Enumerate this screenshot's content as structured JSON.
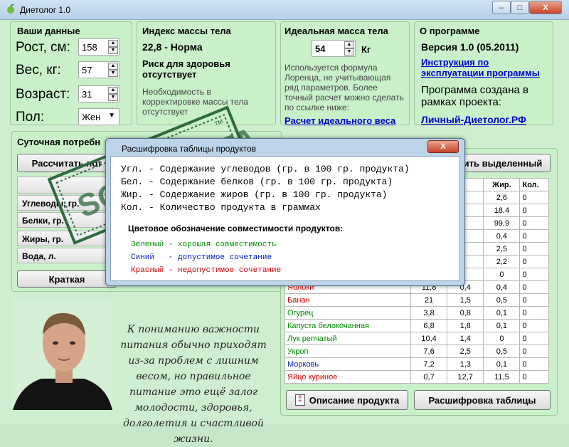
{
  "window": {
    "title": "Диетолог 1.0",
    "min": "–",
    "max": "□",
    "close": "X"
  },
  "your_data": {
    "title": "Ваши данные",
    "height_label": "Рост, см:",
    "height_value": "158",
    "weight_label": "Вес, кг:",
    "weight_value": "57",
    "age_label": "Возраст:",
    "age_value": "31",
    "sex_label": "Пол:",
    "sex_value": "Жен"
  },
  "bmi": {
    "title": "Индекс массы тела",
    "value": "22,8 - Норма",
    "risk": "Риск для здоровья отсутствует",
    "note": "Необходимость в корректировке массы тела отсутствует"
  },
  "ideal": {
    "title": "Идеальная масса тела",
    "value": "54",
    "unit": "Кг",
    "note": "Используется формула Лоренца, не учитывающая ряд параметров. Более точный расчет можно сделать по ссылке ниже:",
    "link": "Расчет идеального веса"
  },
  "about": {
    "title": "О программе",
    "version": "Версия 1.0 (05.2011)",
    "manual_link": "Инструкция по эксплуатации программы",
    "created": "Программа создана в рамках проекта:",
    "site_link": "Личный-Диетолог.РФ"
  },
  "daily": {
    "title": "Суточная потребн",
    "calc_button": "Рассчитать пот",
    "rows": [
      "Углеводы, гр.",
      "Белки, гр.",
      "Жиры, гр.",
      "Вода, л."
    ],
    "short_button": "Краткая"
  },
  "products": {
    "delete_button": "ить выделенный",
    "headers": [
      "Жир.",
      "Кол."
    ],
    "top_rows": [
      {
        "fat": "2,6",
        "qty": "0"
      },
      {
        "fat": "18,4",
        "qty": "0"
      },
      {
        "fat": "99,9",
        "qty": "0"
      },
      {
        "fat": "0,4",
        "qty": "0"
      },
      {
        "fat": "2,5",
        "qty": "0"
      },
      {
        "fat": "2,2",
        "qty": "0"
      },
      {
        "fat": "0",
        "qty": "0"
      }
    ],
    "rows": [
      {
        "name": "Яблоки",
        "carb": "11,8",
        "prot": "0,4",
        "fat": "0,4",
        "qty": "0",
        "color": "red"
      },
      {
        "name": "Банан",
        "carb": "21",
        "prot": "1,5",
        "fat": "0,5",
        "qty": "0",
        "color": "red"
      },
      {
        "name": "Огурец",
        "carb": "3,8",
        "prot": "0,8",
        "fat": "0,1",
        "qty": "0",
        "color": "green"
      },
      {
        "name": "Капуста белокочанная",
        "carb": "6,8",
        "prot": "1,8",
        "fat": "0,1",
        "qty": "0",
        "color": "green"
      },
      {
        "name": "Лук репчатый",
        "carb": "10,4",
        "prot": "1,4",
        "fat": "0",
        "qty": "0",
        "color": "green"
      },
      {
        "name": "Укроп",
        "carb": "7,6",
        "prot": "2,5",
        "fat": "0,5",
        "qty": "0",
        "color": "green"
      },
      {
        "name": "Морковь",
        "carb": "7,2",
        "prot": "1,3",
        "fat": "0,1",
        "qty": "0",
        "color": "blue"
      },
      {
        "name": "Яйцо куриное",
        "carb": "0,7",
        "prot": "12,7",
        "fat": "11,5",
        "qty": "0",
        "color": "red"
      }
    ],
    "desc_button": "Описание продукта",
    "decode_button": "Расшифровка таблицы"
  },
  "quote": "К пониманию важности питания обычно приходят из-за проблем с лишним весом, но правильное питание это ещё залог молодости, здоровья, долголетия и счастливой жизни.",
  "dialog": {
    "title": "Расшифровка таблицы продуктов",
    "close": "X",
    "lines": [
      "Угл. - Содержание углеводов (гр. в 100 гр. продукта)",
      "Бел. - Содержание белков (гр. в 100 гр. продукта)",
      "Жир. - Содержание жиров (гр. в 100 гр. продукта)",
      "Кол. - Количество продукта в граммах"
    ],
    "legend_title": "Цветовое обозначение совместимости продуктов:",
    "legend": [
      {
        "text": "Зеленый - хорошая совместимость",
        "color": "#008a00"
      },
      {
        "text": "Синий   - допустимое сочетание",
        "color": "#0018c8"
      },
      {
        "text": "Красный - недопустимое сочетание",
        "color": "#d20000"
      }
    ]
  },
  "watermark": {
    "text": "SOFTPORTAL",
    "tm": "™",
    "url": "www.softportal.com"
  },
  "colors": {
    "panel": "#c9f0c9",
    "link": "#0000d8",
    "green": "#008a00",
    "blue": "#0018c8",
    "red": "#d20000"
  }
}
